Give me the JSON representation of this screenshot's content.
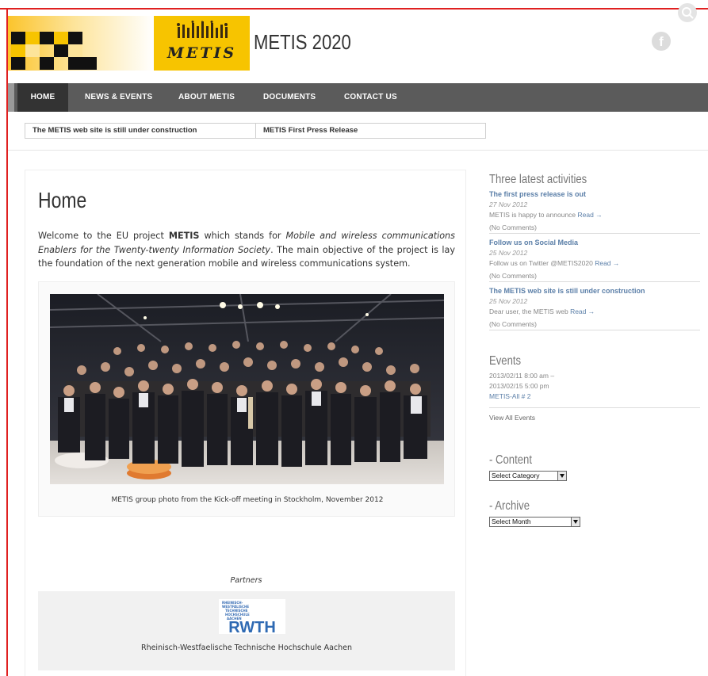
{
  "site": {
    "title": "METIS 2020",
    "logo_text": "METIS"
  },
  "nav": {
    "items": [
      {
        "label": "HOME",
        "active": true
      },
      {
        "label": "NEWS & EVENTS"
      },
      {
        "label": "ABOUT METIS"
      },
      {
        "label": "DOCUMENTS"
      },
      {
        "label": "CONTACT US"
      }
    ]
  },
  "ticker": {
    "items": [
      "The METIS web site is still under construction",
      "METIS First Press Release"
    ]
  },
  "main": {
    "title": "Home",
    "intro": {
      "p1": "Welcome to the EU project ",
      "metis": "METIS",
      "p2": " which stands for ",
      "expansion": "Mobile and wireless communications Enablers for the Twenty-twenty Information Society",
      "p3": ". The main objective of the project is lay the foundation of the next generation mobile and wireless communications system."
    },
    "photo_caption": "METIS group photo from the Kick-off meeting in Stockholm, November 2012",
    "partners_label": "Partners",
    "partner": {
      "logo_lines": [
        "RHEINISCH-",
        "WESTFÄLISCHE",
        "TECHNISCHE",
        "HOCHSCHULE",
        "AACHEN"
      ],
      "logo_word": "RWTH",
      "name": "Rheinisch-Westfaelische Technische Hochschule Aachen"
    }
  },
  "sidebar": {
    "activities_title": "Three latest activities",
    "activities": [
      {
        "title": "The first press release is out",
        "date": "27 Nov 2012",
        "excerpt": "METIS is happy to announce",
        "read": "Read →",
        "comments": "(No Comments)"
      },
      {
        "title": "Follow us on Social Media",
        "date": "25 Nov 2012",
        "excerpt": "Follow us on Twitter @METIS2020",
        "read": "Read →",
        "comments": "(No Comments)"
      },
      {
        "title": "The METIS web site is still under construction",
        "date": "25 Nov 2012",
        "excerpt": "Dear user, the METIS web",
        "read": "Read →",
        "comments": "(No Comments)"
      }
    ],
    "events_title": "Events",
    "event": {
      "start": "2013/02/11 8:00 am –",
      "end": "2013/02/15 5:00 pm",
      "name": "METIS-All # 2"
    },
    "view_all": "View All Events",
    "content_title": "- Content",
    "content_select": "Select Category",
    "archive_title": "- Archive",
    "archive_select": "Select Month"
  },
  "colors": {
    "nav_bg": "#5b5b5b",
    "nav_active": "#333333",
    "link": "#5b7fa8",
    "logo_yellow": "#f7c400"
  },
  "icons": {
    "search": "search-icon",
    "facebook": "facebook-icon"
  }
}
